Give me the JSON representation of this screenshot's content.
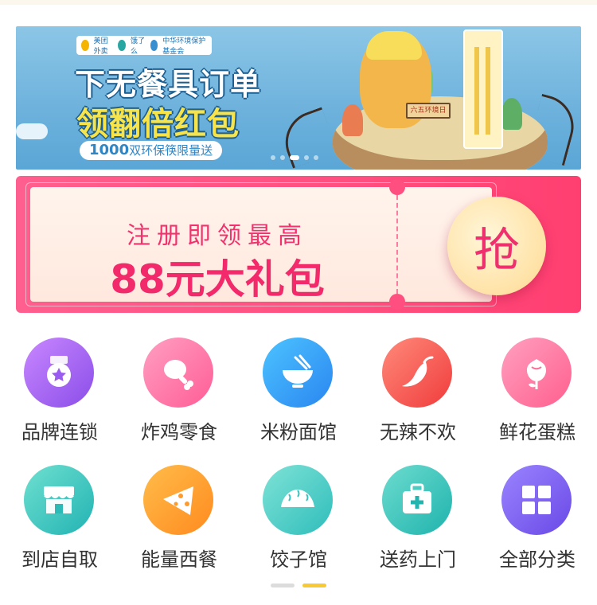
{
  "banner": {
    "logos": [
      "美团外卖",
      "饿了么",
      "中华环境保护基金会"
    ],
    "line1": "下无餐具订单",
    "line2": "领翻倍红包",
    "pill_number": "1000",
    "pill_text": "双环保筷限量送",
    "sign_text": "六五环境日",
    "carousel_total": 5,
    "carousel_active": 2
  },
  "coupon": {
    "title": "注册即领最高",
    "amount": "88元大礼包",
    "button": "抢"
  },
  "categories": [
    {
      "label": "品牌连锁",
      "icon": "medal-icon"
    },
    {
      "label": "炸鸡零食",
      "icon": "drumstick-icon"
    },
    {
      "label": "米粉面馆",
      "icon": "noodle-bowl-icon"
    },
    {
      "label": "无辣不欢",
      "icon": "chili-icon"
    },
    {
      "label": "鲜花蛋糕",
      "icon": "flower-icon"
    },
    {
      "label": "到店自取",
      "icon": "store-icon"
    },
    {
      "label": "能量西餐",
      "icon": "pizza-icon"
    },
    {
      "label": "饺子馆",
      "icon": "dumpling-icon"
    },
    {
      "label": "送药上门",
      "icon": "medicine-box-icon"
    },
    {
      "label": "全部分类",
      "icon": "grid-icon"
    }
  ],
  "colors": {
    "coupon_pink": "#ff4f80",
    "coupon_text": "#f2296a",
    "pager_active": "#f7c934",
    "label_text": "#333333"
  },
  "pager": {
    "total": 2,
    "active": 1
  }
}
